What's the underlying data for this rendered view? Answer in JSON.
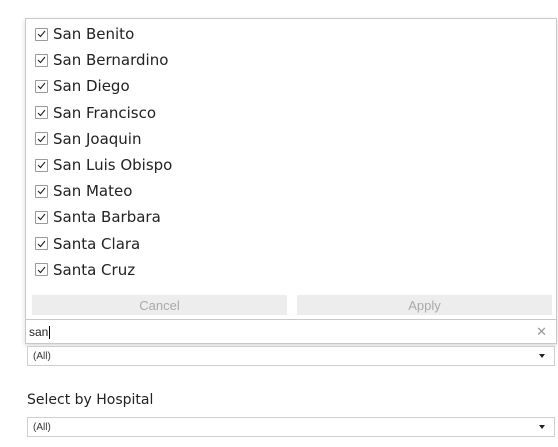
{
  "filter_popup": {
    "items": [
      {
        "label": "San Benito",
        "checked": true
      },
      {
        "label": "San Bernardino",
        "checked": true
      },
      {
        "label": "San Diego",
        "checked": true
      },
      {
        "label": "San Francisco",
        "checked": true
      },
      {
        "label": "San Joaquin",
        "checked": true
      },
      {
        "label": "San Luis Obispo",
        "checked": true
      },
      {
        "label": "San Mateo",
        "checked": true
      },
      {
        "label": "Santa Barbara",
        "checked": true
      },
      {
        "label": "Santa Clara",
        "checked": true
      },
      {
        "label": "Santa Cruz",
        "checked": true
      }
    ],
    "cancel_label": "Cancel",
    "apply_label": "Apply",
    "search_value": "san",
    "clear_icon": "close-icon"
  },
  "county_dropdown": {
    "value": "(All)"
  },
  "hospital_filter": {
    "label": "Select by Hospital",
    "value": "(All)"
  },
  "colors": {
    "checkbox_border": "#9a9a9a",
    "button_bg": "#ededed",
    "button_text": "#a9a9a9"
  }
}
